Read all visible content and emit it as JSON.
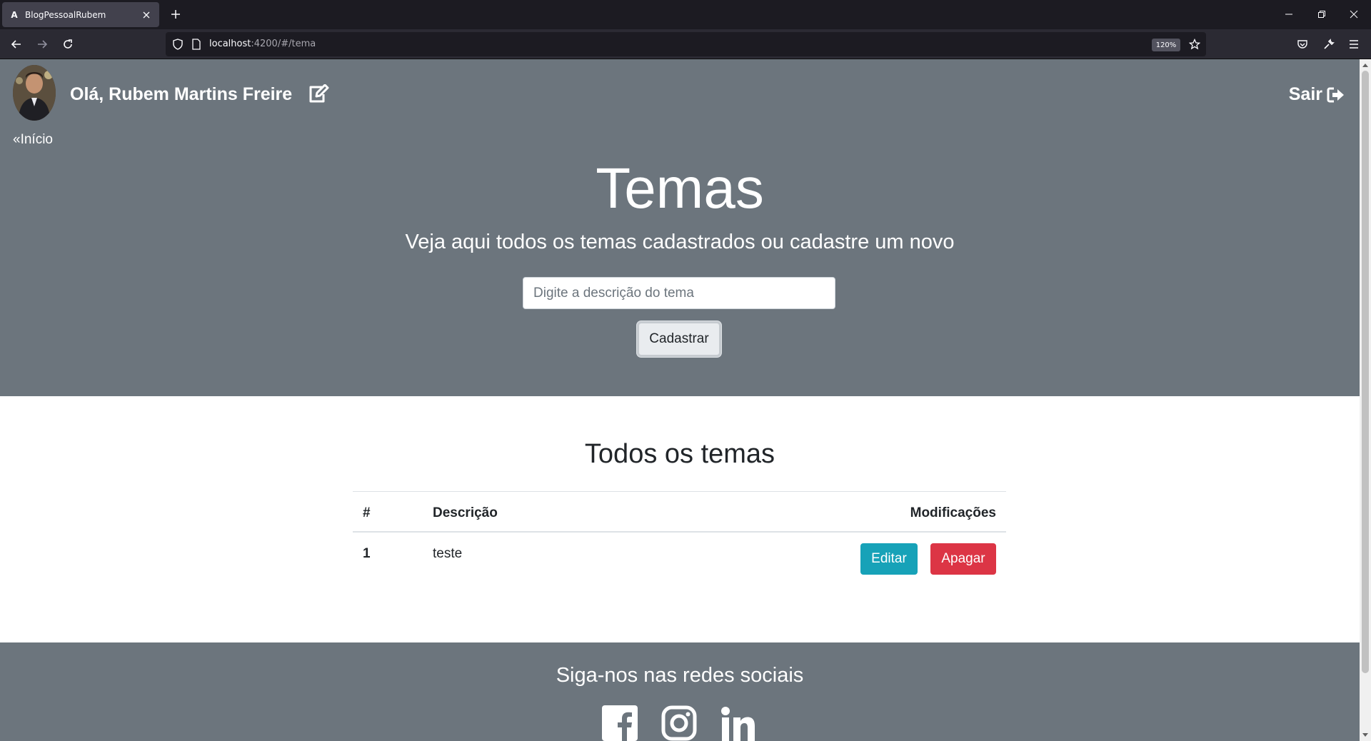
{
  "browser": {
    "tab_title": "BlogPessoalRubem",
    "url_host": "localhost",
    "url_rest": ":4200/#/tema",
    "zoom": "120%"
  },
  "header": {
    "greeting": "Olá, Rubem Martins Freire",
    "logout_label": "Sair",
    "back_link": "«Início"
  },
  "hero": {
    "title": "Temas",
    "subtitle": "Veja aqui todos os temas cadastrados ou cadastre um novo",
    "input_placeholder": "Digite a descrição do tema",
    "input_value": "",
    "submit_label": "Cadastrar"
  },
  "themes": {
    "title": "Todos os temas",
    "columns": [
      "#",
      "Descrição",
      "Modificações"
    ],
    "rows": [
      {
        "id": "1",
        "description": "teste",
        "edit_label": "Editar",
        "delete_label": "Apagar"
      }
    ]
  },
  "footer": {
    "title": "Siga-nos nas redes sociais",
    "icons": [
      "facebook-icon",
      "instagram-icon",
      "linkedin-icon"
    ]
  },
  "colors": {
    "hero_bg": "#6c757d",
    "edit_btn": "#17a2b8",
    "delete_btn": "#dc3545"
  }
}
